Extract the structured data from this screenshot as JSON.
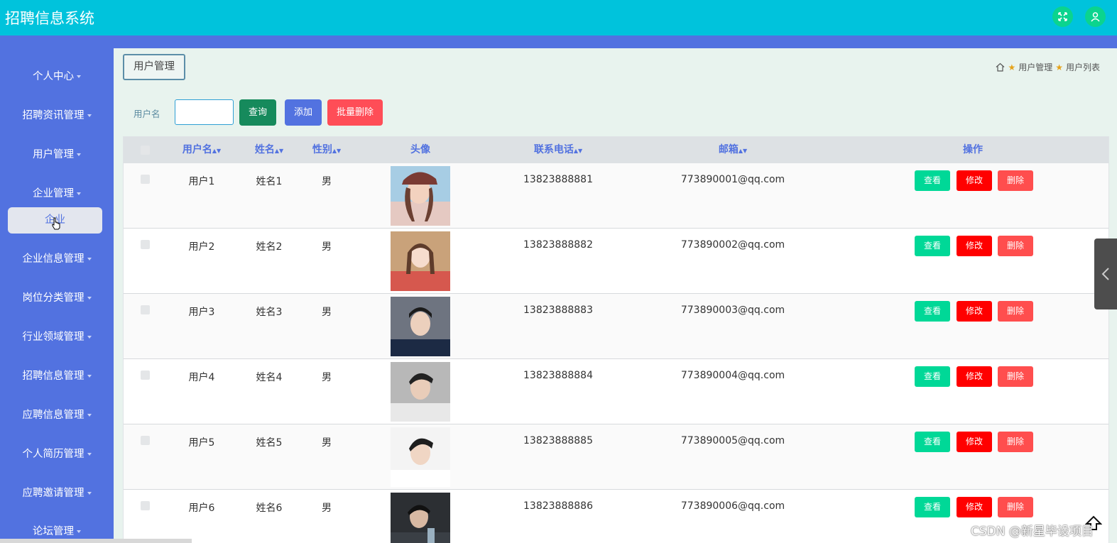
{
  "header": {
    "title": "招聘信息系统"
  },
  "sidebar": {
    "items": [
      {
        "label": "个人中心"
      },
      {
        "label": "招聘资讯管理"
      },
      {
        "label": "用户管理"
      },
      {
        "label": "企业管理"
      },
      {
        "label": "企业信息管理"
      },
      {
        "label": "岗位分类管理"
      },
      {
        "label": "行业领域管理"
      },
      {
        "label": "招聘信息管理"
      },
      {
        "label": "应聘信息管理"
      },
      {
        "label": "个人简历管理"
      },
      {
        "label": "应聘邀请管理"
      },
      {
        "label": "论坛管理"
      }
    ],
    "active_sub": "企业"
  },
  "main": {
    "page_tab": "用户管理",
    "breadcrumb": [
      "用户管理",
      "用户列表"
    ],
    "search": {
      "label": "用户名",
      "value": ""
    },
    "buttons": {
      "query": "查询",
      "add": "添加",
      "batch_delete": "批量删除"
    },
    "table": {
      "columns": [
        "用户名",
        "姓名",
        "性别",
        "头像",
        "联系电话",
        "邮箱",
        "操作"
      ],
      "rows": [
        {
          "username": "用户1",
          "name": "姓名1",
          "gender": "男",
          "phone": "13823888881",
          "email": "773890001@qq.com"
        },
        {
          "username": "用户2",
          "name": "姓名2",
          "gender": "男",
          "phone": "13823888882",
          "email": "773890002@qq.com"
        },
        {
          "username": "用户3",
          "name": "姓名3",
          "gender": "男",
          "phone": "13823888883",
          "email": "773890003@qq.com"
        },
        {
          "username": "用户4",
          "name": "姓名4",
          "gender": "男",
          "phone": "13823888884",
          "email": "773890004@qq.com"
        },
        {
          "username": "用户5",
          "name": "姓名5",
          "gender": "男",
          "phone": "13823888885",
          "email": "773890005@qq.com"
        },
        {
          "username": "用户6",
          "name": "姓名6",
          "gender": "男",
          "phone": "13823888886",
          "email": "773890006@qq.com"
        }
      ],
      "actions": {
        "view": "查看",
        "edit": "修改",
        "delete": "删除"
      }
    }
  },
  "watermark": "CSDN @新星毕设项目",
  "colors": {
    "header": "#00c3dc",
    "sidebar": "#5272e0",
    "view": "#00d897",
    "edit": "#ff0000",
    "delete": "#ff4e4e",
    "query": "#168a5c",
    "batch_delete": "#ff4d57"
  }
}
